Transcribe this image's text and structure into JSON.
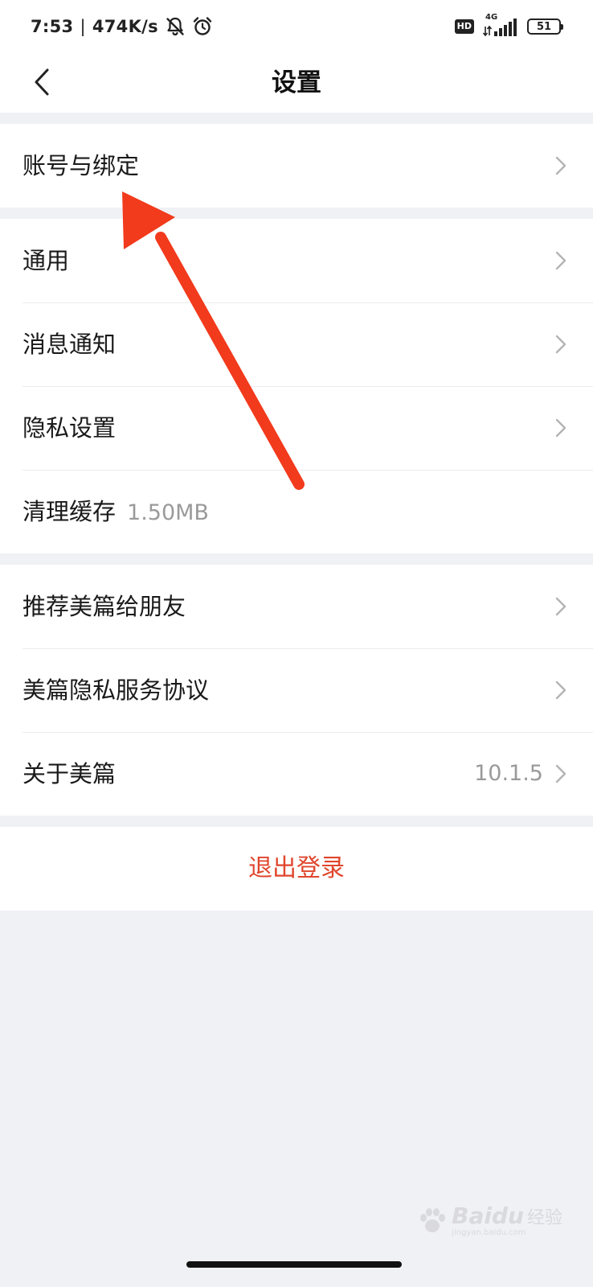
{
  "status_bar": {
    "time": "7:53",
    "net_speed": "474K/s",
    "hd_badge": "HD",
    "signal_type": "4G",
    "battery": "51",
    "icons": [
      "muted-bell-icon",
      "alarm-icon",
      "signal-icon",
      "battery-icon"
    ]
  },
  "header": {
    "title": "设置",
    "back_icon": "chevron-left-icon"
  },
  "groups": [
    {
      "items": [
        {
          "label": "账号与绑定",
          "value": "",
          "has_chevron": true
        }
      ]
    },
    {
      "items": [
        {
          "label": "通用",
          "value": "",
          "has_chevron": true
        },
        {
          "label": "消息通知",
          "value": "",
          "has_chevron": true
        },
        {
          "label": "隐私设置",
          "value": "",
          "has_chevron": true
        },
        {
          "label": "清理缓存",
          "extra": "1.50MB",
          "has_chevron": false
        }
      ]
    },
    {
      "items": [
        {
          "label": "推荐美篇给朋友",
          "value": "",
          "has_chevron": true
        },
        {
          "label": "美篇隐私服务协议",
          "value": "",
          "has_chevron": true
        },
        {
          "label": "关于美篇",
          "value": "10.1.5",
          "has_chevron": true
        }
      ]
    }
  ],
  "logout": {
    "label": "退出登录"
  },
  "colors": {
    "background": "#f0f1f5",
    "surface": "#ffffff",
    "danger": "#e0462d",
    "annotation_arrow": "#f23a1c",
    "secondary_text": "#9a9a9a"
  },
  "watermark": {
    "brand": "Baidu",
    "suffix": "经验",
    "url": "jingyan.baidu.com"
  }
}
